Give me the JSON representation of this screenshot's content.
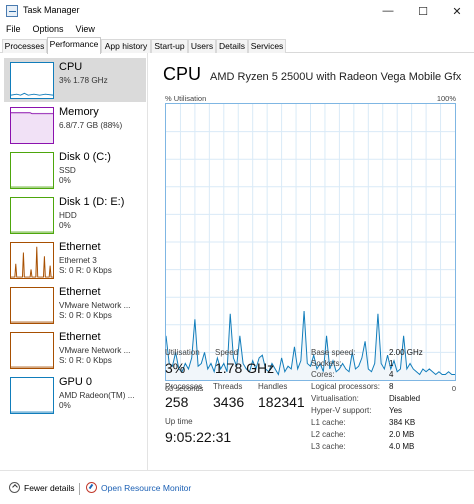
{
  "window": {
    "title": "Task Manager",
    "minimize": "—",
    "maximize": "☐",
    "close": "✕"
  },
  "menu": [
    "File",
    "Options",
    "View"
  ],
  "tabs": [
    "Processes",
    "Performance",
    "App history",
    "Start-up",
    "Users",
    "Details",
    "Services"
  ],
  "active_tab": "Performance",
  "sidebar": {
    "items": [
      {
        "title": "CPU",
        "lines": [
          "3% 1.78 GHz"
        ],
        "color": "#117dbb"
      },
      {
        "title": "Memory",
        "lines": [
          "6.8/7.7 GB (88%)"
        ],
        "color": "#8b12ae"
      },
      {
        "title": "Disk 0 (C:)",
        "lines": [
          "SSD",
          "0%"
        ],
        "color": "#4da60c"
      },
      {
        "title": "Disk 1 (D: E:)",
        "lines": [
          "HDD",
          "0%"
        ],
        "color": "#4da60c"
      },
      {
        "title": "Ethernet",
        "lines": [
          "Ethernet 3",
          "S: 0 R: 0 Kbps"
        ],
        "color": "#a74f01"
      },
      {
        "title": "Ethernet",
        "lines": [
          "VMware Network ...",
          "S: 0 R: 0 Kbps"
        ],
        "color": "#a74f01"
      },
      {
        "title": "Ethernet",
        "lines": [
          "VMware Network ...",
          "S: 0 R: 0 Kbps"
        ],
        "color": "#a74f01"
      },
      {
        "title": "GPU 0",
        "lines": [
          "AMD Radeon(TM) ...",
          "0%"
        ],
        "color": "#117dbb"
      }
    ]
  },
  "cpu": {
    "title": "CPU",
    "model": "AMD Ryzen 5 2500U with Radeon Vega Mobile Gfx",
    "util_label": "% Utilisation",
    "util_max": "100%",
    "time_left": "60 seconds",
    "time_right": "0",
    "utilisation_label": "Utilisation",
    "utilisation": "3%",
    "speed_label": "Speed",
    "speed": "1.78 GHz",
    "processes_label": "Processes",
    "processes": "258",
    "threads_label": "Threads",
    "threads": "3436",
    "handles_label": "Handles",
    "handles": "182341",
    "uptime_label": "Up time",
    "uptime": "9:05:22:31",
    "specs": [
      {
        "k": "Base speed:",
        "v": "2.00 GHz"
      },
      {
        "k": "Sockets:",
        "v": "1"
      },
      {
        "k": "Cores:",
        "v": "4"
      },
      {
        "k": "Logical processors:",
        "v": "8"
      },
      {
        "k": "Virtualisation:",
        "v": "Disabled"
      },
      {
        "k": "Hyper-V support:",
        "v": "Yes"
      },
      {
        "k": "L1 cache:",
        "v": "384 KB"
      },
      {
        "k": "L2 cache:",
        "v": "2.0 MB"
      },
      {
        "k": "L3 cache:",
        "v": "4.0 MB"
      }
    ],
    "graph_values": [
      16,
      6,
      5,
      10,
      4,
      3,
      6,
      4,
      8,
      22,
      5,
      6,
      10,
      4,
      6,
      3,
      8,
      4,
      6,
      3,
      24,
      8,
      5,
      16,
      6,
      4,
      3,
      7,
      4,
      8,
      9,
      4,
      3,
      6,
      4,
      2,
      8,
      3,
      5,
      4,
      12,
      4,
      7,
      25,
      6,
      5,
      9,
      4,
      6,
      3,
      16,
      4,
      7,
      3,
      4,
      6,
      4,
      3,
      10,
      4,
      5,
      8,
      14,
      4,
      3,
      6,
      24,
      6,
      4,
      9,
      4,
      7,
      3,
      4,
      16,
      4,
      6,
      4,
      3,
      2,
      4,
      3,
      4,
      3,
      2,
      3,
      2,
      2,
      3,
      2,
      2
    ]
  },
  "footer": {
    "fewer_details": "Fewer details",
    "open_resource_monitor": "Open Resource Monitor"
  }
}
